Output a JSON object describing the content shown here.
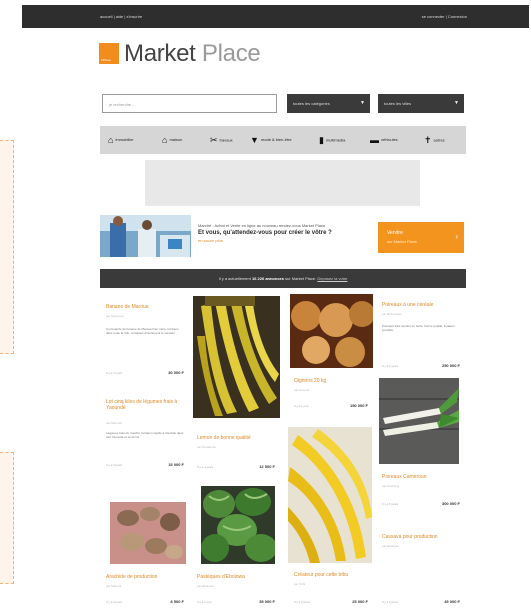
{
  "topbar": {
    "left": "accueil | aide | s'inscrire",
    "right": "se connecter | Connexion"
  },
  "logo": {
    "badge": "MPlace",
    "word1": "Market",
    "word2": " Place"
  },
  "search": {
    "placeholder": "je recherche...",
    "select_category": "toutes les catégories",
    "select_city": "toutes les villes"
  },
  "categories": [
    {
      "icon": "house-icon",
      "label": "immobilier"
    },
    {
      "icon": "home-icon",
      "label": "maison"
    },
    {
      "icon": "tools-icon",
      "label": "travaux"
    },
    {
      "icon": "shirt-icon",
      "label": "mode & bien-être"
    },
    {
      "icon": "device-icon",
      "label": "multimédia"
    },
    {
      "icon": "car-icon",
      "label": "véhicules"
    },
    {
      "icon": "hammer-icon",
      "label": "autres"
    }
  ],
  "promo": {
    "intro": "Marché : Achat et Vente en ligne au nouveau rendez-vous Market Place",
    "question": "Et vous, qu'attendez-vous pour créer le vôtre ?",
    "link": "en savoir plus",
    "button_line1": "Vendre",
    "button_line2": "sur Market Place"
  },
  "counter": {
    "prefix": "Il y a actuellement ",
    "count": "16 226 annonces",
    "suffix": " sur Market Place.",
    "link": "Deposez la votre"
  },
  "listings": [
    {
      "title": "Banane de Maroua",
      "sub": "par  Ngoumou",
      "desc": "Commande de banane de Maroua bien mûre, livraison dans toute la ville, contactez directement le vendeur.",
      "meta": "Il y a 2 jours",
      "price": "30 000 F"
    },
    {
      "title": "Lot cinq kilos de légumes frais à Yaoundé",
      "sub": "par  Mfoundi",
      "desc": "Légumes frais du marché, livraison rapide à domicile dans tout Yaoundé et environs.",
      "meta": "Il y a 3 jours",
      "price": "15 000 F"
    },
    {
      "title": "Lemon de bonne qualité",
      "sub": "par  Douala 3e",
      "meta": "Il y a 4 jours",
      "price": "12 500 F"
    },
    {
      "title": "Oignons 20 kg",
      "sub": "par  Garoua",
      "meta": "Il y a 1 jour",
      "price": "150 000 F"
    },
    {
      "title": "Poireaux à une céréale",
      "sub": "par  Bafoussam",
      "desc": "Poireaux frais vendus en botte, bonne qualité, livraison possible.",
      "meta": "Il y a 2 jours",
      "price": "250 000 F"
    },
    {
      "title": "Poireaux Cameroun",
      "sub": "par  Dschang",
      "meta": "Il y a 5 jours",
      "price": "300 000 F"
    },
    {
      "title": "Arachide de production",
      "sub": "par  Maroua",
      "desc": "Arachide locale séchée, disponible en sacs, vente en gros et au détail.",
      "meta": "Il y a 3 jours",
      "price": "8 500 F"
    },
    {
      "title": "Cassava pour production",
      "sub": "par  Ebolowa",
      "meta": "Il y a 6 jours",
      "price": "45 000 F"
    },
    {
      "title": "Pastèques d'Ebolowa",
      "sub": "par  Ebolowa",
      "meta": "Il y a 1 jour",
      "price": "35 000 F"
    },
    {
      "title": "Créateur pour cette tribu",
      "sub": "par  Kribi",
      "meta": "Il y a 2 jours",
      "price": "25 000 F"
    }
  ]
}
